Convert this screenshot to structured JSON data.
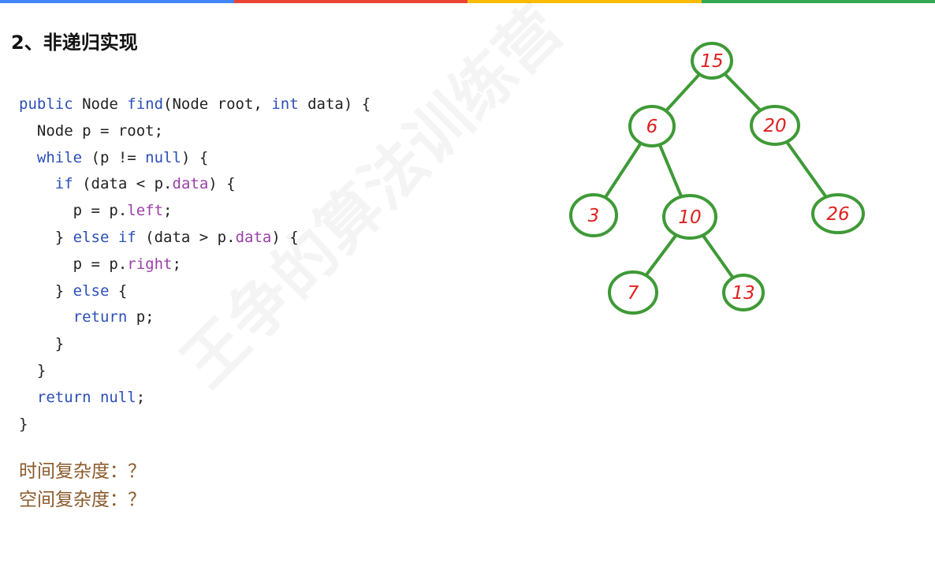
{
  "top_bar_colors": [
    "#4285f4",
    "#ea4335",
    "#fbbc05",
    "#34a853"
  ],
  "title": "2、非递归实现",
  "code": {
    "line0": [
      {
        "t": "public",
        "c": "kw"
      },
      {
        "t": " Node "
      },
      {
        "t": "find",
        "c": "kw"
      },
      {
        "t": "(Node root, "
      },
      {
        "t": "int",
        "c": "kw"
      },
      {
        "t": " data) {"
      }
    ],
    "line1": [
      {
        "t": "  Node p = root;"
      }
    ],
    "line2": [
      {
        "t": "  "
      },
      {
        "t": "while",
        "c": "kw"
      },
      {
        "t": " (p != "
      },
      {
        "t": "null",
        "c": "kw"
      },
      {
        "t": ") {"
      }
    ],
    "line3": [
      {
        "t": "    "
      },
      {
        "t": "if",
        "c": "kw"
      },
      {
        "t": " (data < p."
      },
      {
        "t": "data",
        "c": "fld"
      },
      {
        "t": ") {"
      }
    ],
    "line4": [
      {
        "t": "      p = p."
      },
      {
        "t": "left",
        "c": "fld"
      },
      {
        "t": ";"
      }
    ],
    "line5": [
      {
        "t": "    } "
      },
      {
        "t": "else if",
        "c": "kw"
      },
      {
        "t": " (data > p."
      },
      {
        "t": "data",
        "c": "fld"
      },
      {
        "t": ") {"
      }
    ],
    "line6": [
      {
        "t": "      p = p."
      },
      {
        "t": "right",
        "c": "fld"
      },
      {
        "t": ";"
      }
    ],
    "line7": [
      {
        "t": "    } "
      },
      {
        "t": "else",
        "c": "kw"
      },
      {
        "t": " {"
      }
    ],
    "line8": [
      {
        "t": "      "
      },
      {
        "t": "return",
        "c": "kw"
      },
      {
        "t": " p;"
      }
    ],
    "line9": [
      {
        "t": "    }"
      }
    ],
    "line10": [
      {
        "t": "  }"
      }
    ],
    "line11": [
      {
        "t": "  "
      },
      {
        "t": "return",
        "c": "kw"
      },
      {
        "t": " "
      },
      {
        "t": "null",
        "c": "kw"
      },
      {
        "t": ";"
      }
    ],
    "line12": [
      {
        "t": "}"
      }
    ]
  },
  "time_complexity": "时间复杂度：？",
  "space_complexity": "空间复杂度：？",
  "watermark": "王争的算法训练营",
  "tree": {
    "node_color": "#3e9a36",
    "label_color": "#e02020",
    "nodes": [
      "15",
      "6",
      "20",
      "3",
      "10",
      "26",
      "7",
      "13"
    ],
    "edges": [
      [
        "15",
        "6"
      ],
      [
        "15",
        "20"
      ],
      [
        "6",
        "3"
      ],
      [
        "6",
        "10"
      ],
      [
        "20",
        "26"
      ],
      [
        "10",
        "7"
      ],
      [
        "10",
        "13"
      ]
    ]
  }
}
